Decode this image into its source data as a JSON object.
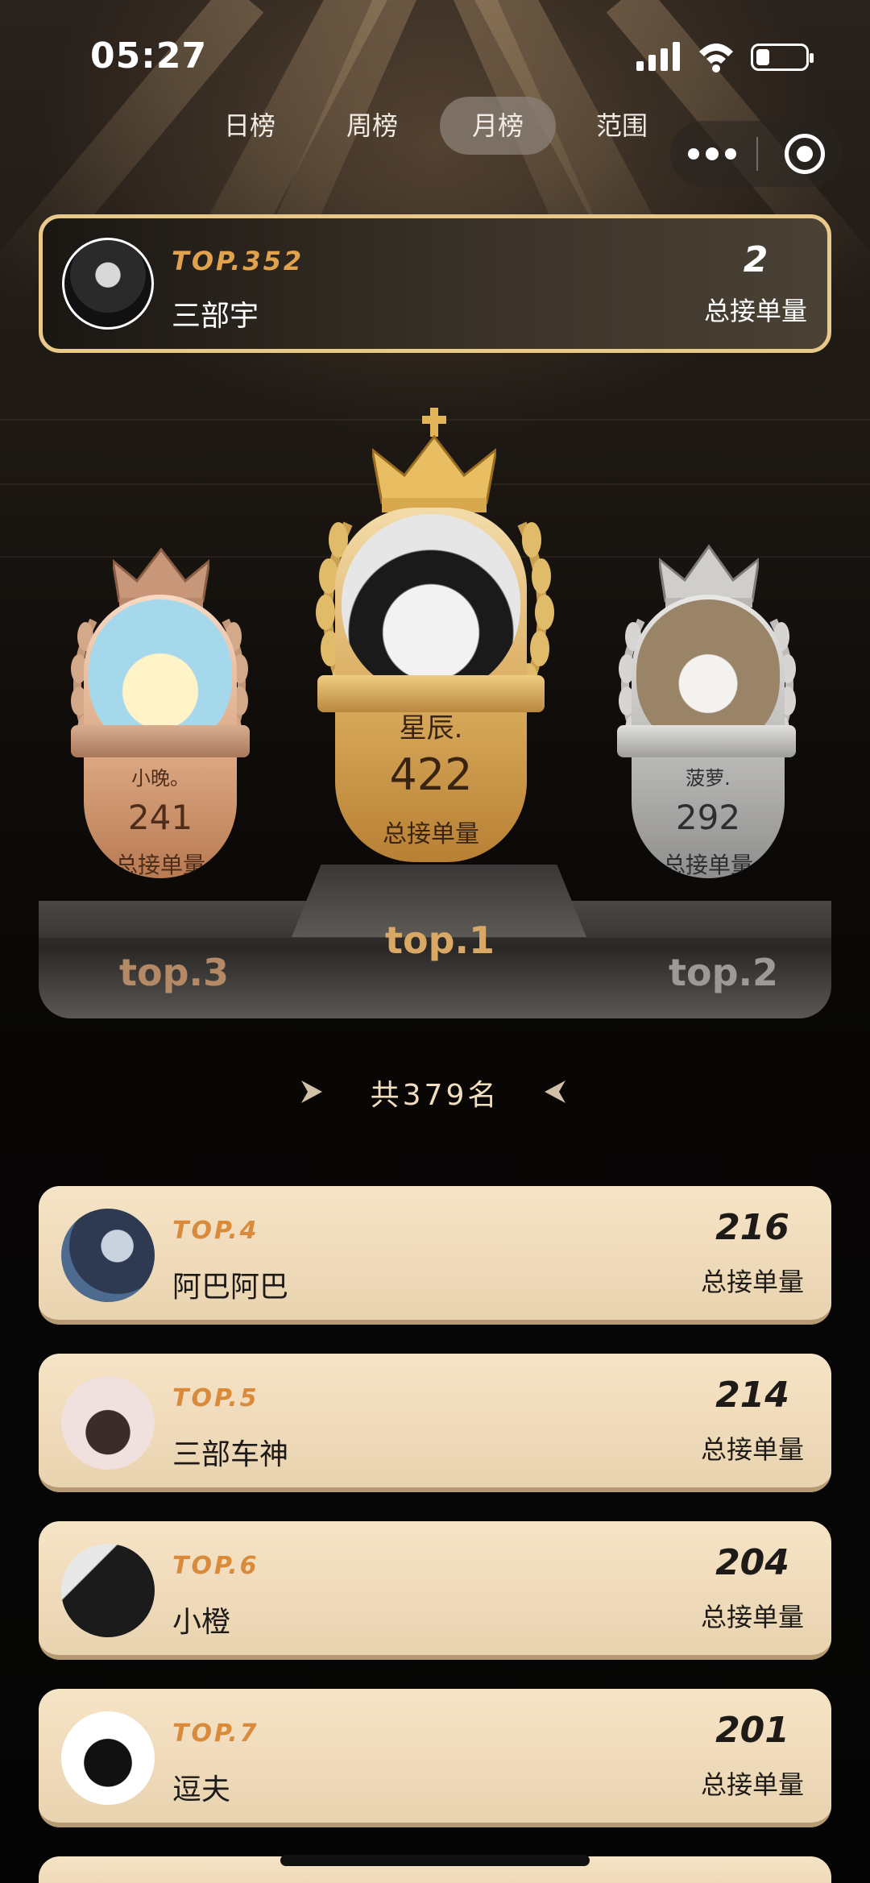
{
  "status_bar": {
    "time": "05:27"
  },
  "tabs": [
    {
      "label": "日榜",
      "active": false
    },
    {
      "label": "周榜",
      "active": false
    },
    {
      "label": "月榜",
      "active": true
    },
    {
      "label": "范围",
      "active": false
    }
  ],
  "my_rank": {
    "rank": "TOP.352",
    "name": "三部宇",
    "count": "2",
    "count_label": "总接单量"
  },
  "podium": {
    "first": {
      "name": "星辰.",
      "value": "422",
      "label": "总接单量",
      "place": "top.1"
    },
    "second": {
      "name": "菠萝.",
      "value": "292",
      "label": "总接单量",
      "place": "top.2"
    },
    "third": {
      "name": "小晚。",
      "value": "241",
      "label": "总接单量",
      "place": "top.3"
    }
  },
  "total": {
    "prefix": "共",
    "count": "379",
    "suffix": "名"
  },
  "list": [
    {
      "rank": "TOP.4",
      "name": "阿巴阿巴",
      "count": "216",
      "count_label": "总接单量"
    },
    {
      "rank": "TOP.5",
      "name": "三部车神",
      "count": "214",
      "count_label": "总接单量"
    },
    {
      "rank": "TOP.6",
      "name": "小橙",
      "count": "204",
      "count_label": "总接单量"
    },
    {
      "rank": "TOP.7",
      "name": "逗夫",
      "count": "201",
      "count_label": "总接单量"
    }
  ],
  "colors": {
    "gold": "#e8c98a",
    "rank_orange": "#d98a3a",
    "gold_pill": "#c8954a",
    "silver_pill": "#b9b8b6",
    "bronze_pill": "#c48a62"
  }
}
